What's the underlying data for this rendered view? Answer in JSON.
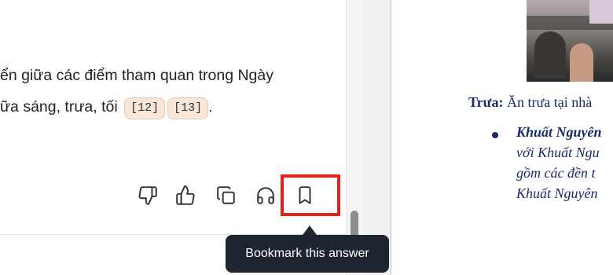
{
  "answer": {
    "line1": "ển giữa các điểm tham quan trong Ngày",
    "line2": "ữa sáng, trưa, tối",
    "citations": [
      "[12]",
      "[13]"
    ],
    "line2_end": "."
  },
  "actions": {
    "dislike_icon": "thumbs-down-icon",
    "like_icon": "thumbs-up-icon",
    "copy_icon": "copy-icon",
    "listen_icon": "headphones-icon",
    "bookmark_icon": "bookmark-icon",
    "highlight_color": "#e8201a"
  },
  "tooltip": {
    "text": "Bookmark this answer"
  },
  "document": {
    "heading_label": "Trưa:",
    "heading_text": " Ăn trưa tại nhà",
    "list_lines": [
      "Khuất Nguyên",
      "với Khuất Ngu",
      "gồm các đền t",
      "Khuất Nguyên"
    ],
    "text_color": "#1b2a6b"
  }
}
